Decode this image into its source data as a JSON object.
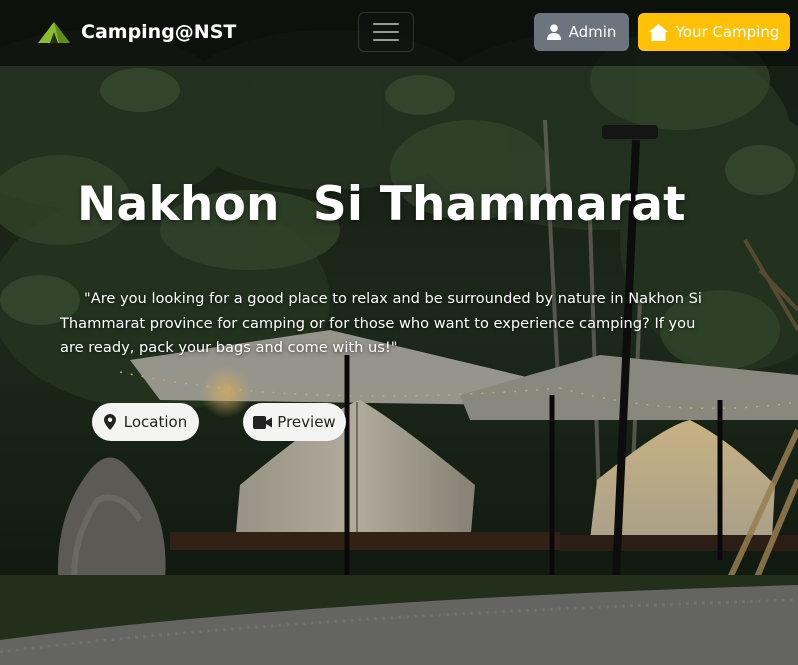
{
  "navbar": {
    "brand": "Camping@NST",
    "admin_label": "Admin",
    "your_camping_label": "Your Camping"
  },
  "hero": {
    "title": "Nakhon  Si Thammarat",
    "description": "\"Are you looking for a good place to relax and be surrounded by nature in Nakhon Si Thammarat province for camping or for those who want to experience camping? If you are ready, pack your bags and come with us!\"",
    "location_label": "Location",
    "preview_label": "Preview"
  },
  "colors": {
    "admin_button": "#6c757d",
    "camping_button": "#ffc107",
    "pill_background": "#f4f4f2"
  },
  "icons": {
    "brand": "tent-icon",
    "toggler": "hamburger-menu-icon",
    "admin": "user-icon",
    "your_camping": "home-icon",
    "location": "map-pin-icon",
    "preview": "video-camera-icon"
  }
}
